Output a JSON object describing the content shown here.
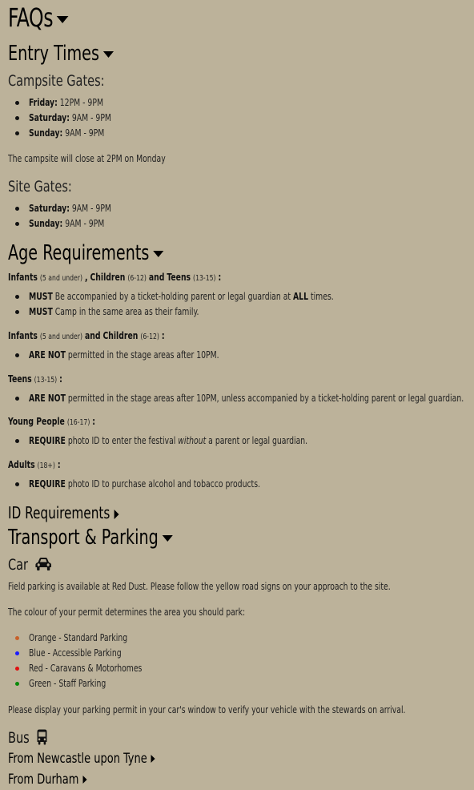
{
  "faqs": {
    "title": "FAQs"
  },
  "entry": {
    "title": "Entry Times",
    "campsite": {
      "title": "Campsite Gates:",
      "items": [
        {
          "day": "Friday:",
          "time": "12PM - 9PM"
        },
        {
          "day": "Saturday:",
          "time": "9AM - 9PM"
        },
        {
          "day": "Sunday:",
          "time": "9AM - 9PM"
        }
      ],
      "note": "The campsite will close at 2PM on Monday"
    },
    "site": {
      "title": "Site Gates:",
      "items": [
        {
          "day": "Saturday:",
          "time": "9AM - 9PM"
        },
        {
          "day": "Sunday:",
          "time": "9AM - 9PM"
        }
      ]
    }
  },
  "age": {
    "title": "Age Requirements",
    "g1": {
      "a": "Infants",
      "a_s": "(5 and under)",
      "sep1": ",",
      "b": "Children",
      "b_s": "(6-12)",
      "and": "and",
      "c": "Teens",
      "c_s": "(13-15)",
      "colon": ":",
      "items": [
        {
          "pre": "MUST",
          "text": "Be accompanied by a ticket-holding parent or legal guardian at",
          "bold2": "ALL",
          "tail": "times."
        },
        {
          "pre": "MUST",
          "text": "Camp in the same area as their family."
        }
      ]
    },
    "g2": {
      "a": "Infants",
      "a_s": "(5 and under)",
      "and": "and",
      "b": "Children",
      "b_s": "(6-12)",
      "colon": ":",
      "items": [
        {
          "pre": "ARE NOT",
          "text": "permitted in the stage areas after 10PM."
        }
      ]
    },
    "g3": {
      "a": "Teens",
      "a_s": "(13-15)",
      "colon": ":",
      "items": [
        {
          "pre": "ARE NOT",
          "text": "permitted in the stage areas after 10PM, unless accompanied by a ticket-holding parent or legal guardian."
        }
      ]
    },
    "g4": {
      "a": "Young People",
      "a_s": "(16-17)",
      "colon": ":",
      "items": [
        {
          "pre": "REQUIRE",
          "text": "photo ID to enter the festival",
          "ital": "without",
          "tail": "a parent or legal guardian."
        }
      ]
    },
    "g5": {
      "a": "Adults",
      "a_s": "(18+)",
      "colon": ":",
      "items": [
        {
          "pre": "REQUIRE",
          "text": "photo ID to purchase alcohol and tobacco products."
        }
      ]
    }
  },
  "id_req": {
    "title": "ID Requirements"
  },
  "transport": {
    "title": "Transport & Parking",
    "car": {
      "title": "Car",
      "icon": "car-icon",
      "p1": "Field parking is available at Red Dust. Please follow the yellow road signs on your approach to the site.",
      "p2": "The colour of your permit determines the area you should park:",
      "items": [
        {
          "label": "Orange - Standard Parking",
          "color": "#c8602a"
        },
        {
          "label": "Blue - Accessible Parking",
          "color": "#1a1aff"
        },
        {
          "label": "Red - Caravans & Motorhomes",
          "color": "#e01010"
        },
        {
          "label": "Green - Staff Parking",
          "color": "#0a8a0a"
        }
      ],
      "p3": "Please display your parking permit in your car's window to verify your vehicle with the stewards on arrival."
    },
    "bus": {
      "title": "Bus",
      "icon": "bus-icon",
      "routes": [
        {
          "label": "From Newcastle upon Tyne"
        },
        {
          "label": "From Durham"
        }
      ]
    }
  }
}
